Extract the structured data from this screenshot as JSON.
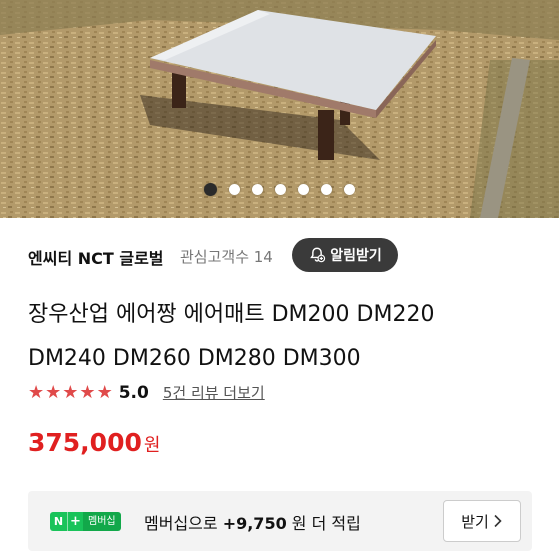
{
  "hero": {
    "dot_count": 7,
    "active_dot": 0
  },
  "seller": {
    "name": "엔씨티 NCT 글로벌",
    "interest": "관심고객수 14",
    "alarm_label": "알림받기"
  },
  "product": {
    "title_line1": "장우산업 에어짱 에어매트 DM200 DM220",
    "title_line2": "DM240 DM260 DM280 DM300",
    "rating": "5.0",
    "star_count": 5,
    "reviews_link": "5건 리뷰 더보기",
    "price": "375,000",
    "price_unit": "원"
  },
  "membership": {
    "badge_n": "N",
    "badge_plus": "+",
    "badge_label": "멤버십",
    "text_prefix": "멤버십으로 ",
    "points": "+9,750",
    "text_suffix": " 원 더 적립",
    "button_label": "받기",
    "button_icon": "chevron-right-icon"
  },
  "colors": {
    "price": "#e02020",
    "star": "#e04a4a",
    "alarm_bg": "#3a3a3a",
    "naver_green": "#19c35a"
  }
}
